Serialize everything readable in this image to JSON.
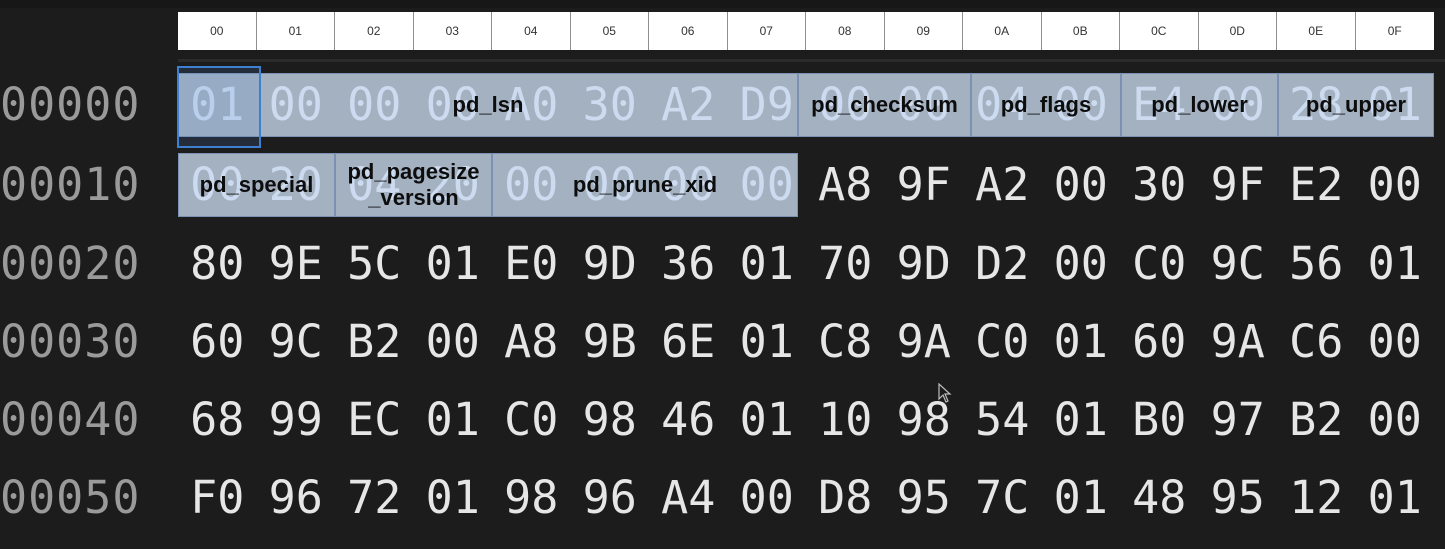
{
  "header": {
    "columns": [
      "00",
      "01",
      "02",
      "03",
      "04",
      "05",
      "06",
      "07",
      "08",
      "09",
      "0A",
      "0B",
      "0C",
      "0D",
      "0E",
      "0F"
    ]
  },
  "rows": [
    {
      "offset": "00000",
      "bytes": [
        "01",
        "00",
        "00",
        "00",
        "A0",
        "30",
        "A2",
        "D9",
        "00",
        "00",
        "04",
        "00",
        "E4",
        "00",
        "28",
        "01"
      ]
    },
    {
      "offset": "00010",
      "bytes": [
        "00",
        "20",
        "04",
        "20",
        "00",
        "00",
        "00",
        "00",
        "A8",
        "9F",
        "A2",
        "00",
        "30",
        "9F",
        "E2",
        "00"
      ]
    },
    {
      "offset": "00020",
      "bytes": [
        "80",
        "9E",
        "5C",
        "01",
        "E0",
        "9D",
        "36",
        "01",
        "70",
        "9D",
        "D2",
        "00",
        "C0",
        "9C",
        "56",
        "01"
      ]
    },
    {
      "offset": "00030",
      "bytes": [
        "60",
        "9C",
        "B2",
        "00",
        "A8",
        "9B",
        "6E",
        "01",
        "C8",
        "9A",
        "C0",
        "01",
        "60",
        "9A",
        "C6",
        "00"
      ]
    },
    {
      "offset": "00040",
      "bytes": [
        "68",
        "99",
        "EC",
        "01",
        "C0",
        "98",
        "46",
        "01",
        "10",
        "98",
        "54",
        "01",
        "B0",
        "97",
        "B2",
        "00"
      ]
    },
    {
      "offset": "00050",
      "bytes": [
        "F0",
        "96",
        "72",
        "01",
        "98",
        "96",
        "A4",
        "00",
        "D8",
        "95",
        "7C",
        "01",
        "48",
        "95",
        "12",
        "01"
      ]
    }
  ],
  "fields": [
    {
      "id": "pd-lsn",
      "label": "pd_lsn"
    },
    {
      "id": "pd-checksum",
      "label": "pd_checksum"
    },
    {
      "id": "pd-flags",
      "label": "pd_flags"
    },
    {
      "id": "pd-lower",
      "label": "pd_lower"
    },
    {
      "id": "pd-upper",
      "label": "pd_upper"
    },
    {
      "id": "pd-special",
      "label": "pd_special"
    },
    {
      "id": "pd-pagesize-version",
      "label_line1": "pd_pagesize",
      "label_line2": "_version"
    },
    {
      "id": "pd-prune-xid",
      "label": "pd_prune_xid"
    }
  ]
}
